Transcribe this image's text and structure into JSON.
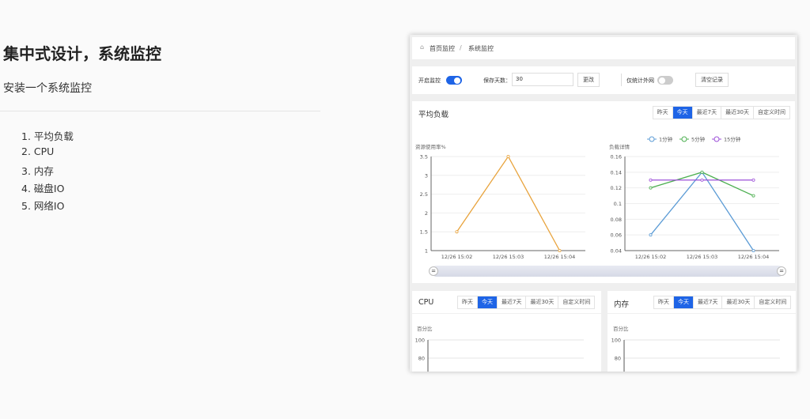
{
  "doc": {
    "title": "集中式设计，系统监控",
    "subtitle": "安装一个系统监控",
    "items": [
      "1. 平均负载",
      "2. CPU",
      "3. 内存",
      "4. 磁盘IO",
      "5. 网络IO"
    ]
  },
  "app": {
    "breadcrumb": [
      "首页监控",
      "/",
      "系统监控"
    ],
    "toolbar": {
      "monitor_label": "开启监控",
      "monitor_on": true,
      "days_label": "保存天数：",
      "days_value": "30",
      "change_btn": "更改",
      "external_label": "仅统计外网",
      "external_on": false,
      "clear_btn": "清空记录"
    },
    "ranges": [
      "昨天",
      "今天",
      "最近7天",
      "最近30天",
      "自定义时间"
    ],
    "selected_range": "今天",
    "load_title": "平均负载",
    "cpu_title": "CPU",
    "mem_title": "内存",
    "accent": "#1e64e6"
  },
  "chart_data": [
    {
      "type": "line",
      "ylabel": "资源使用率%",
      "categories": [
        "12/26 15:02",
        "12/26 15:03",
        "12/26 15:04"
      ],
      "ylim": [
        1,
        3.5
      ],
      "yticks": [
        "1",
        "1.5",
        "2",
        "2.5",
        "3",
        "3.5"
      ],
      "series": [
        {
          "values": [
            1.5,
            3.5,
            1
          ],
          "color": "#e8a33c"
        }
      ],
      "grid": true
    },
    {
      "type": "line",
      "ylabel": "负载详情",
      "categories": [
        "12/26 15:02",
        "12/26 15:03",
        "12/26 15:04"
      ],
      "ylim": [
        0.04,
        0.16
      ],
      "yticks": [
        "0.04",
        "0.06",
        "0.08",
        "0.1",
        "0.12",
        "0.14",
        "0.16"
      ],
      "legend": "top",
      "series": [
        {
          "name": "1分钟",
          "values": [
            0.06,
            0.14,
            0.04
          ],
          "color": "#5b9bd5"
        },
        {
          "name": "5分钟",
          "values": [
            0.12,
            0.14,
            0.11
          ],
          "color": "#4caf50"
        },
        {
          "name": "15分钟",
          "values": [
            0.13,
            0.13,
            0.13
          ],
          "color": "#9c4fd8"
        }
      ],
      "grid": true
    },
    {
      "type": "line",
      "ylabel": "百分比",
      "yticks": [
        "80",
        "100"
      ],
      "series": []
    },
    {
      "type": "line",
      "ylabel": "百分比",
      "yticks": [
        "80",
        "100"
      ],
      "series": []
    }
  ]
}
